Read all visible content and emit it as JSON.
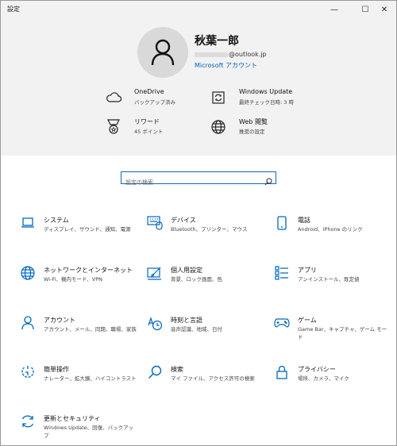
{
  "window": {
    "title": "設定",
    "minimize": "—",
    "maximize": "☐",
    "close": "✕"
  },
  "account": {
    "name": "秋葉一郎",
    "email_suffix": "@outlook.jp",
    "link": "Microsoft アカウント"
  },
  "quick": [
    {
      "title": "OneDrive",
      "sub": "バックアップ済み",
      "icon": "cloud-icon"
    },
    {
      "title": "Windows Update",
      "sub": "最終チェック日時: 3 時",
      "icon": "refresh-icon"
    },
    {
      "title": "リワード",
      "sub": "45 ポイント",
      "icon": "medal-icon"
    },
    {
      "title": "Web 閲覧",
      "sub": "推奨の設定",
      "icon": "globe-icon"
    }
  ],
  "search": {
    "placeholder": "設定の検索",
    "icon": "search-icon"
  },
  "categories": [
    {
      "title": "システム",
      "sub": "ディスプレイ、サウンド、通知、電源",
      "icon": "laptop-icon"
    },
    {
      "title": "デバイス",
      "sub": "Bluetooth、プリンター、マウス",
      "icon": "keyboard-icon"
    },
    {
      "title": "電話",
      "sub": "Android、iPhone のリンク",
      "icon": "phone-icon"
    },
    {
      "title": "ネットワークとインターネット",
      "sub": "Wi-Fi、機内モード、VPN",
      "icon": "globe-icon"
    },
    {
      "title": "個人用設定",
      "sub": "背景、ロック画面、色",
      "icon": "paint-icon"
    },
    {
      "title": "アプリ",
      "sub": "アンインストール、既定値",
      "icon": "apps-list-icon"
    },
    {
      "title": "アカウント",
      "sub": "アカウント、メール、同期、職場、家族",
      "icon": "person-icon"
    },
    {
      "title": "時刻と言語",
      "sub": "音声認識、地域、日付",
      "icon": "time-language-icon"
    },
    {
      "title": "ゲーム",
      "sub": "Game Bar、キャプチャ、ゲーム モード",
      "icon": "gamepad-icon"
    },
    {
      "title": "簡単操作",
      "sub": "ナレーター、拡大鏡、ハイコントラスト",
      "icon": "ease-of-access-icon"
    },
    {
      "title": "検索",
      "sub": "マイ ファイル、アクセス許可の検索",
      "icon": "search-icon"
    },
    {
      "title": "プライバシー",
      "sub": "場所、カメラ、マイク",
      "icon": "lock-icon"
    },
    {
      "title": "更新とセキュリティ",
      "sub": "Windows Update、回復、バックアップ",
      "icon": "sync-icon"
    }
  ],
  "colors": {
    "accent": "#0067c0",
    "header_bg": "#f2f2f2"
  }
}
